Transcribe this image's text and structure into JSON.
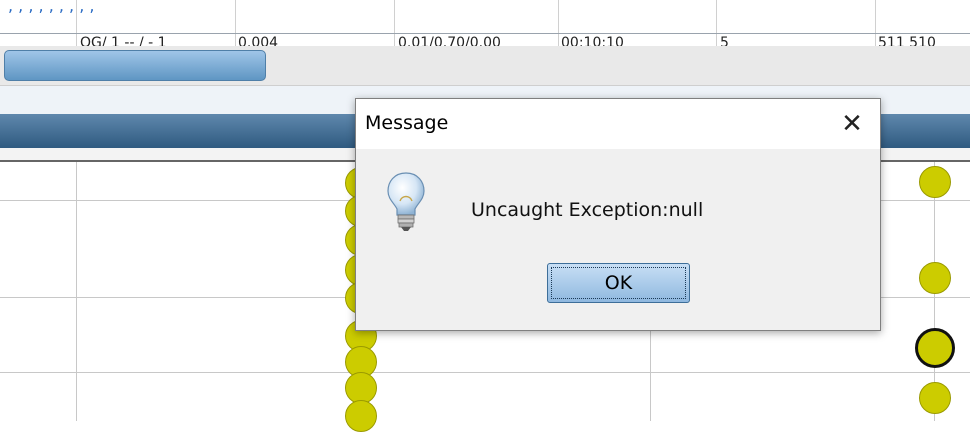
{
  "table": {
    "top_row_text": ", , , , , , , , ,",
    "row_cells": [
      "",
      "OG/ 1 -- / - 1",
      "0.004",
      "0.01/0.70/0.00",
      "00:10:10",
      "5",
      "511 510"
    ]
  },
  "dialog": {
    "title": "Message",
    "close_glyph": "✕",
    "message": "Uncaught Exception:null",
    "ok_label": "OK",
    "icon": "lightbulb-info-icon"
  },
  "plot": {
    "dot_color": "#cccc00"
  },
  "colors": {
    "header_dark": "#2f5a80",
    "scroll_thumb": "#5f96c3",
    "link_blue": "#2b6cc4"
  }
}
